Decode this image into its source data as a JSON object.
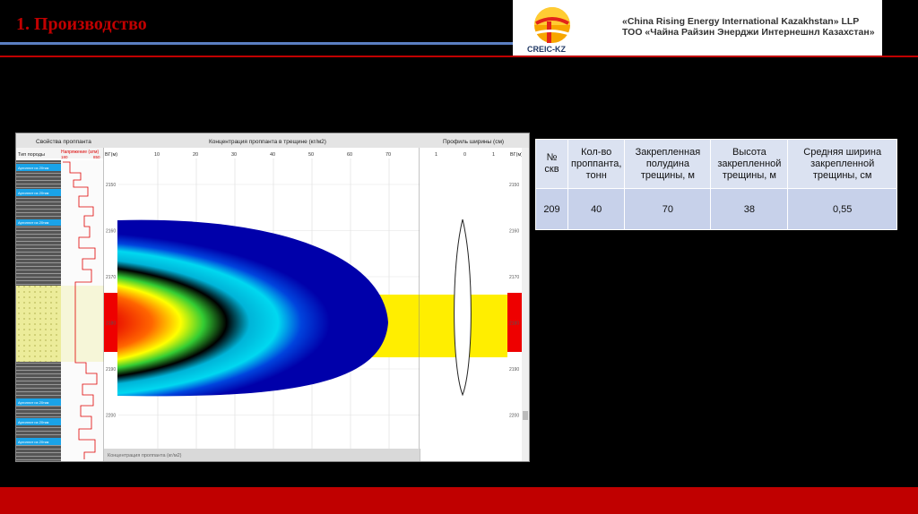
{
  "slide": {
    "title": "1. Производство"
  },
  "logo": {
    "abbr": "CREIC-KZ",
    "line1": "«China Rising Energy International Kazakhstan» LLP",
    "line2": "ТОО «Чайна Райзин Энерджи Интернешнл Казахстан»"
  },
  "panel": {
    "left_header": "Свойства проппанта",
    "col_rock": "Тип породы",
    "col_stress": "Напряжение (атм)",
    "stress_min": "180",
    "stress_max": "850",
    "center_header": "Концентрация проппанта в трещине (кг/м2)",
    "depth_label": "ВГ(м)",
    "conc_ticks": [
      "10",
      "20",
      "30",
      "40",
      "50",
      "60",
      "70"
    ],
    "right_header": "Профиль ширины (см)",
    "width_ticks": [
      "1",
      "0",
      "1"
    ],
    "depth_ticks": [
      "2150",
      "2160",
      "2170",
      "2180",
      "2190",
      "2200"
    ],
    "footer_tab": "Концентрация проппанта (кг/м2)",
    "rock_labels": [
      "Аргиллит из 20ткм",
      "Аргиллит из 20ткм",
      "Аргиллит из 20ткм",
      "Аргиллит из 20ткм",
      "Аргиллит из 20ткм",
      "Аргиллит из 20ткм"
    ]
  },
  "table": {
    "headers": [
      "№ скв",
      "Кол-во проппанта, тонн",
      "Закрепленная полудина трещины, м",
      "Высота закрепленной трещины, м",
      "Средняя ширина закрепленной трещины, см"
    ],
    "row": [
      "209",
      "40",
      "70",
      "38",
      "0,55"
    ]
  },
  "colors": {
    "accent_red": "#c00000",
    "accent_blue": "#5b7fc2"
  }
}
